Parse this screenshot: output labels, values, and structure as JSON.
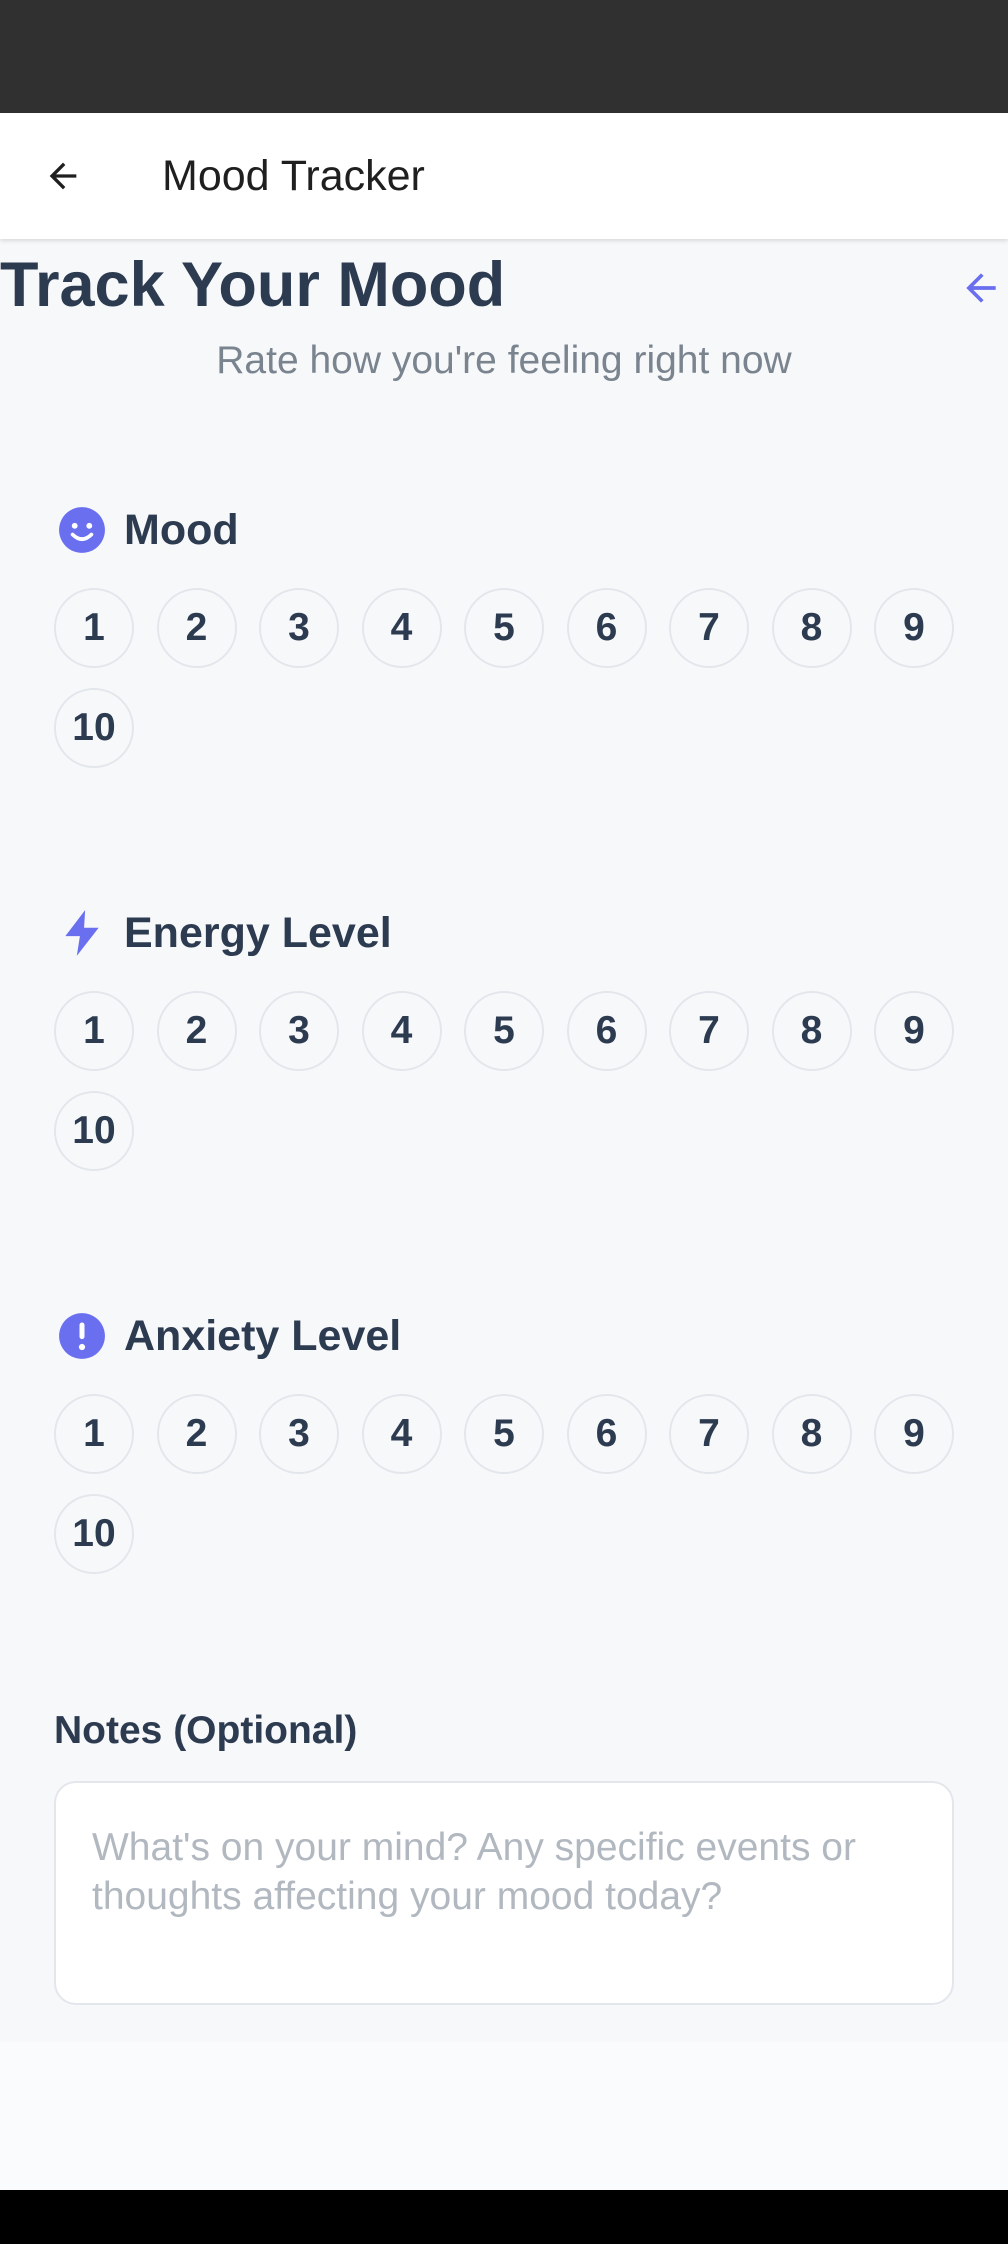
{
  "app_bar": {
    "title": "Mood Tracker",
    "back_icon": "arrow-left-icon"
  },
  "header": {
    "title": "Track Your Mood",
    "subtitle": "Rate how you're feeling right now",
    "side_icon": "arrow-left-icon"
  },
  "sections": [
    {
      "label": "Mood",
      "icon": "smile-icon",
      "values": [
        "1",
        "2",
        "3",
        "4",
        "5",
        "6",
        "7",
        "8",
        "9",
        "10"
      ]
    },
    {
      "label": "Energy Level",
      "icon": "lightning-icon",
      "values": [
        "1",
        "2",
        "3",
        "4",
        "5",
        "6",
        "7",
        "8",
        "9",
        "10"
      ]
    },
    {
      "label": "Anxiety Level",
      "icon": "alert-circle-icon",
      "values": [
        "1",
        "2",
        "3",
        "4",
        "5",
        "6",
        "7",
        "8",
        "9",
        "10"
      ]
    }
  ],
  "notes": {
    "label": "Notes (Optional)",
    "placeholder": "What's on your mind? Any specific events or thoughts affecting your mood today?",
    "value": ""
  },
  "colors": {
    "accent": "#6a6ff0",
    "text": "#2d3b50",
    "muted": "#7a848f",
    "border": "#e3e7ec",
    "background": "#f7f8fa"
  }
}
